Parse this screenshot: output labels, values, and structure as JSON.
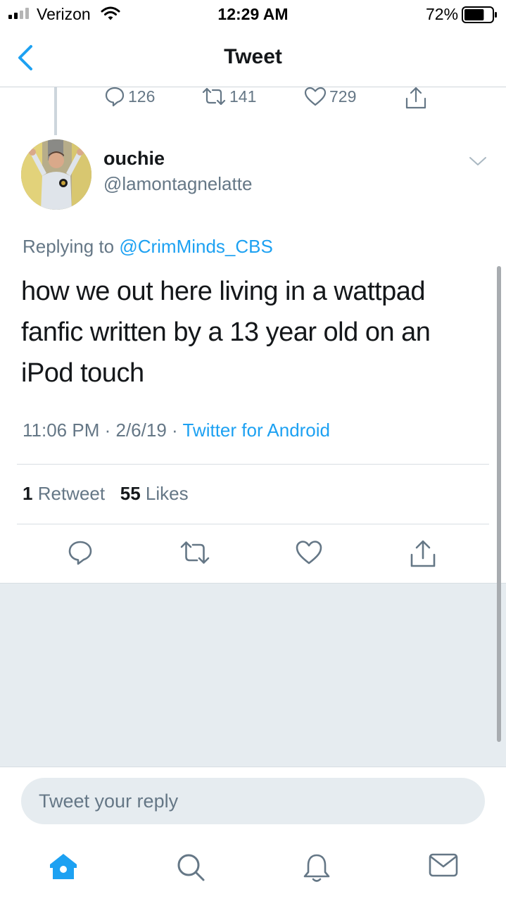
{
  "status_bar": {
    "carrier": "Verizon",
    "time": "12:29 AM",
    "battery": "72%",
    "battery_level": 0.72
  },
  "nav": {
    "title": "Tweet",
    "back_icon": "chevron-left-icon"
  },
  "previous_tweet": {
    "replies": "126",
    "retweets": "141",
    "likes": "729"
  },
  "tweet": {
    "author_name": "ouchie",
    "author_handle": "@lamontagnelatte",
    "replying_prefix": "Replying to",
    "replying_to": "@CrimMinds_CBS",
    "text": "how we out here living in a wattpad fanfic written by a 13 year old on an iPod touch",
    "time": "11:06 PM",
    "separator": "·",
    "date": "2/6/19",
    "source": "Twitter for Android",
    "retweet_count": "1",
    "retweet_label": "Retweet",
    "like_count": "55",
    "like_label": "Likes"
  },
  "reply": {
    "placeholder": "Tweet your reply"
  },
  "tabs": [
    "home-icon",
    "search-icon",
    "notifications-icon",
    "messages-icon"
  ],
  "colors": {
    "accent": "#1da1f2",
    "secondary_text": "#657786",
    "background_gray": "#e6ecf0"
  }
}
